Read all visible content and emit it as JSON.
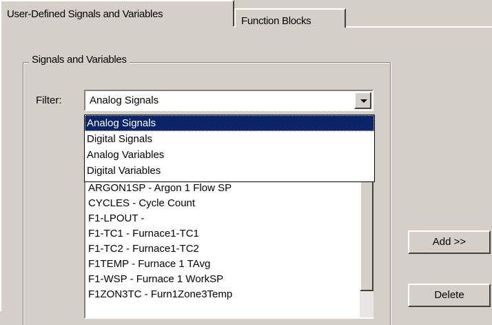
{
  "tabs": [
    {
      "label": "User-Defined Signals and Variables"
    },
    {
      "label": "Function Blocks"
    }
  ],
  "group": {
    "title": "Signals and Variables"
  },
  "filter": {
    "label": "Filter:",
    "value": "Analog Signals",
    "options": [
      "Analog Signals",
      "Digital Signals",
      "Analog Variables",
      "Digital Variables"
    ]
  },
  "list_items": [
    "ARGON1SP - Argon 1 Flow SP",
    "CYCLES - Cycle Count",
    "F1-LPOUT -",
    "F1-TC1 - Furnace1-TC1",
    "F1-TC2 - Furnace1-TC2",
    "F1TEMP - Furnace 1 TAvg",
    "F1-WSP - Furnace 1 WorkSP",
    "F1ZON3TC - Furn1Zone3Temp"
  ],
  "buttons": {
    "add": "Add >>",
    "delete": "Delete"
  }
}
